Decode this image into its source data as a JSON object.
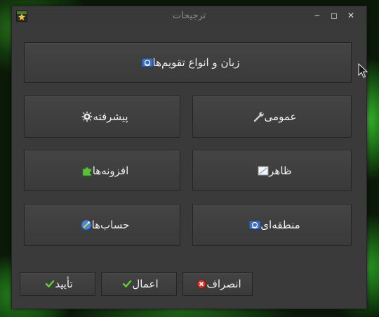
{
  "window": {
    "title": "ترجیحات",
    "controls": {
      "minimize": "‒",
      "maximize": "◻",
      "close": "✕"
    }
  },
  "buttons": {
    "languages_calendars": {
      "label": "زبان و انواع تقویم‌ها",
      "icon": "globe-flag-icon"
    },
    "general": {
      "label": "عمومی",
      "icon": "wrench-icon"
    },
    "advanced": {
      "label": "پیشرفته",
      "icon": "gear-icon"
    },
    "appearance": {
      "label": "ظاهر",
      "icon": "appearance-icon"
    },
    "plugins": {
      "label": "افزونه‌ها",
      "icon": "puzzle-icon"
    },
    "regional": {
      "label": "منطقه‌ای",
      "icon": "globe-flag-icon"
    },
    "accounts": {
      "label": "حساب‌ها",
      "icon": "accounts-icon"
    }
  },
  "footer": {
    "cancel": {
      "label": "انصراف",
      "icon": "cancel-icon"
    },
    "apply": {
      "label": "اعمال",
      "icon": "check-icon"
    },
    "ok": {
      "label": "تأیید",
      "icon": "check-icon"
    }
  },
  "colors": {
    "window_bg": "#3a3a3a",
    "button_bg": "#414141",
    "text": "#f0f0f0",
    "title_text": "#8e8e8e",
    "check_green": "#5fd330",
    "cancel_red": "#d33a2c",
    "globe_blue": "#3b6fc2"
  }
}
